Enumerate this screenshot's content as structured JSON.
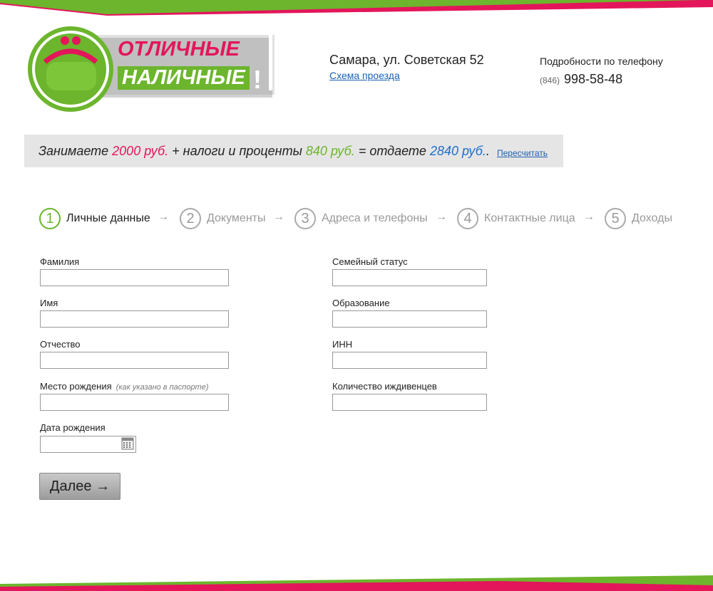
{
  "brand": {
    "logo_line1": "ОТЛИЧНЫЕ",
    "logo_line2": "НАЛИЧНЫЕ",
    "logo_excl": "!",
    "colors": {
      "green": "#6cb52d",
      "pink": "#e3155b",
      "blue": "#1d6fce"
    }
  },
  "contacts": {
    "address": "Самара, ул. Советская 52",
    "route_link": "Схема проезда",
    "phone_label": "Подробности по телефону",
    "phone_code": "(846)",
    "phone_number": "998-58-48"
  },
  "summary": {
    "borrow_text": "Занимаете",
    "borrow_amount": "2000 руб.",
    "fees_text": "+ налоги и проценты",
    "fees_amount": "840 руб.",
    "return_text": "= отдаете",
    "return_amount": "2840 руб.",
    "dot": ".",
    "recalc_link": "Пересчитать"
  },
  "steps": [
    {
      "num": "1",
      "label": "Личные данные",
      "active": true
    },
    {
      "num": "2",
      "label": "Документы",
      "active": false
    },
    {
      "num": "3",
      "label": "Адреса и телефоны",
      "active": false
    },
    {
      "num": "4",
      "label": "Контактные лица",
      "active": false
    },
    {
      "num": "5",
      "label": "Доходы",
      "active": false
    }
  ],
  "step_arrow": "→",
  "form": {
    "lastname_label": "Фамилия",
    "firstname_label": "Имя",
    "patronymic_label": "Отчество",
    "birthplace_label": "Место рождения",
    "birthplace_hint": "(как указано в паспорте)",
    "birthdate_label": "Дата рождения",
    "marital_label": "Семейный статус",
    "education_label": "Образование",
    "inn_label": "ИНН",
    "dependents_label": "Количество иждивенцев",
    "values": {
      "lastname": "",
      "firstname": "",
      "patronymic": "",
      "birthplace": "",
      "birthdate": "",
      "marital": "",
      "education": "",
      "inn": "",
      "dependents": ""
    },
    "next_button": "Далее →"
  }
}
